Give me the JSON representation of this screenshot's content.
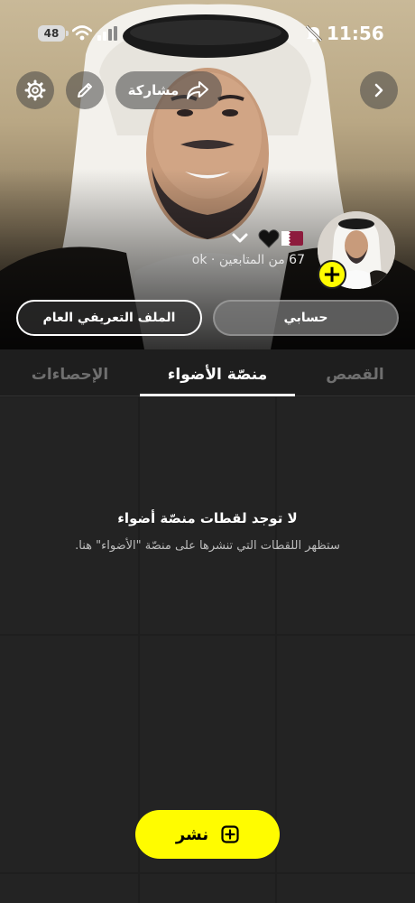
{
  "status_bar": {
    "time": "11:56",
    "battery": "48",
    "icons": [
      "silent-bell-icon",
      "signal-icon",
      "wifi-icon",
      "battery-icon"
    ]
  },
  "header": {
    "share_label": "مشاركة",
    "icons": [
      "settings-icon",
      "pencil-icon",
      "share-arrow-icon",
      "chevron-right-icon"
    ]
  },
  "profile": {
    "followers_line": "67 من المتابعين · ok",
    "flag_emoji": "qatar-flag-icon",
    "heart_emoji": "black-heart-icon",
    "public_profile_label": "الملف التعريفي العام",
    "my_account_label": "حسابي"
  },
  "tabs": [
    {
      "label": "الإحصاءات",
      "active": false
    },
    {
      "label": "منصّة الأضواء",
      "active": true
    },
    {
      "label": "القصص",
      "active": false
    }
  ],
  "empty_state": {
    "title": "لا توجد لقطات منصّة أضواء",
    "subtitle": "ستظهر اللقطات التي تنشرها على منصّة \"الأضواء\" هنا."
  },
  "post_button": {
    "label": "نشر"
  },
  "colors": {
    "accent": "#fffc00",
    "background": "#1e1e1e",
    "grid_cell": "#232323"
  }
}
